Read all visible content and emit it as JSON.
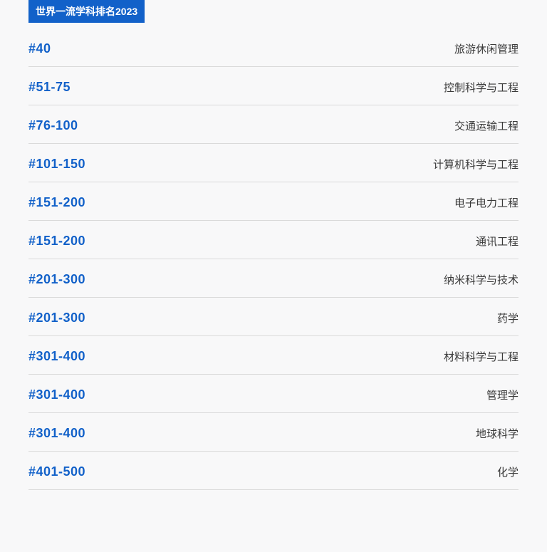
{
  "header": {
    "title": "世界一流学科排名2023"
  },
  "rankings": [
    {
      "rank": "#40",
      "subject": "旅游休闲管理"
    },
    {
      "rank": "#51-75",
      "subject": "控制科学与工程"
    },
    {
      "rank": "#76-100",
      "subject": "交通运输工程"
    },
    {
      "rank": "#101-150",
      "subject": "计算机科学与工程"
    },
    {
      "rank": "#151-200",
      "subject": "电子电力工程"
    },
    {
      "rank": "#151-200",
      "subject": "通讯工程"
    },
    {
      "rank": "#201-300",
      "subject": "纳米科学与技术"
    },
    {
      "rank": "#201-300",
      "subject": "药学"
    },
    {
      "rank": "#301-400",
      "subject": "材料科学与工程"
    },
    {
      "rank": "#301-400",
      "subject": "管理学"
    },
    {
      "rank": "#301-400",
      "subject": "地球科学"
    },
    {
      "rank": "#401-500",
      "subject": "化学"
    }
  ]
}
